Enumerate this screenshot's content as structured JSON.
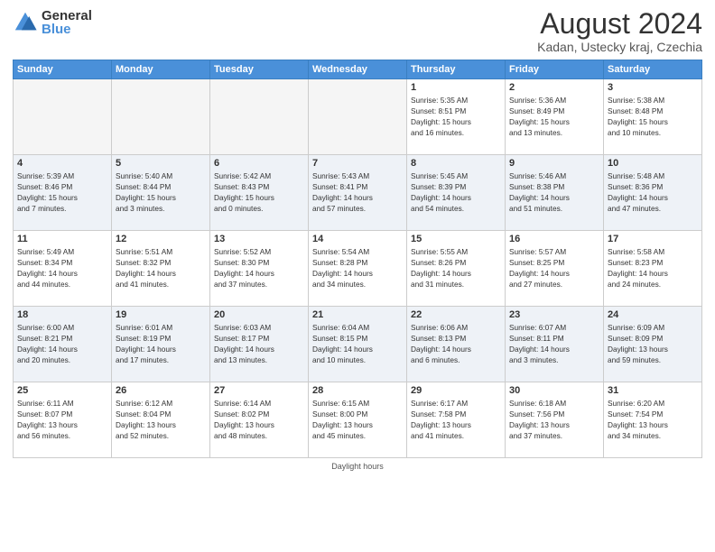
{
  "header": {
    "logo_general": "General",
    "logo_blue": "Blue",
    "month_year": "August 2024",
    "location": "Kadan, Ustecky kraj, Czechia"
  },
  "days_of_week": [
    "Sunday",
    "Monday",
    "Tuesday",
    "Wednesday",
    "Thursday",
    "Friday",
    "Saturday"
  ],
  "footer": {
    "note": "Daylight hours"
  },
  "weeks": [
    {
      "row_class": "row-even",
      "days": [
        {
          "num": "",
          "info": "",
          "empty": true
        },
        {
          "num": "",
          "info": "",
          "empty": true
        },
        {
          "num": "",
          "info": "",
          "empty": true
        },
        {
          "num": "",
          "info": "",
          "empty": true
        },
        {
          "num": "1",
          "info": "Sunrise: 5:35 AM\nSunset: 8:51 PM\nDaylight: 15 hours\nand 16 minutes.",
          "empty": false
        },
        {
          "num": "2",
          "info": "Sunrise: 5:36 AM\nSunset: 8:49 PM\nDaylight: 15 hours\nand 13 minutes.",
          "empty": false
        },
        {
          "num": "3",
          "info": "Sunrise: 5:38 AM\nSunset: 8:48 PM\nDaylight: 15 hours\nand 10 minutes.",
          "empty": false
        }
      ]
    },
    {
      "row_class": "row-odd",
      "days": [
        {
          "num": "4",
          "info": "Sunrise: 5:39 AM\nSunset: 8:46 PM\nDaylight: 15 hours\nand 7 minutes.",
          "empty": false
        },
        {
          "num": "5",
          "info": "Sunrise: 5:40 AM\nSunset: 8:44 PM\nDaylight: 15 hours\nand 3 minutes.",
          "empty": false
        },
        {
          "num": "6",
          "info": "Sunrise: 5:42 AM\nSunset: 8:43 PM\nDaylight: 15 hours\nand 0 minutes.",
          "empty": false
        },
        {
          "num": "7",
          "info": "Sunrise: 5:43 AM\nSunset: 8:41 PM\nDaylight: 14 hours\nand 57 minutes.",
          "empty": false
        },
        {
          "num": "8",
          "info": "Sunrise: 5:45 AM\nSunset: 8:39 PM\nDaylight: 14 hours\nand 54 minutes.",
          "empty": false
        },
        {
          "num": "9",
          "info": "Sunrise: 5:46 AM\nSunset: 8:38 PM\nDaylight: 14 hours\nand 51 minutes.",
          "empty": false
        },
        {
          "num": "10",
          "info": "Sunrise: 5:48 AM\nSunset: 8:36 PM\nDaylight: 14 hours\nand 47 minutes.",
          "empty": false
        }
      ]
    },
    {
      "row_class": "row-even",
      "days": [
        {
          "num": "11",
          "info": "Sunrise: 5:49 AM\nSunset: 8:34 PM\nDaylight: 14 hours\nand 44 minutes.",
          "empty": false
        },
        {
          "num": "12",
          "info": "Sunrise: 5:51 AM\nSunset: 8:32 PM\nDaylight: 14 hours\nand 41 minutes.",
          "empty": false
        },
        {
          "num": "13",
          "info": "Sunrise: 5:52 AM\nSunset: 8:30 PM\nDaylight: 14 hours\nand 37 minutes.",
          "empty": false
        },
        {
          "num": "14",
          "info": "Sunrise: 5:54 AM\nSunset: 8:28 PM\nDaylight: 14 hours\nand 34 minutes.",
          "empty": false
        },
        {
          "num": "15",
          "info": "Sunrise: 5:55 AM\nSunset: 8:26 PM\nDaylight: 14 hours\nand 31 minutes.",
          "empty": false
        },
        {
          "num": "16",
          "info": "Sunrise: 5:57 AM\nSunset: 8:25 PM\nDaylight: 14 hours\nand 27 minutes.",
          "empty": false
        },
        {
          "num": "17",
          "info": "Sunrise: 5:58 AM\nSunset: 8:23 PM\nDaylight: 14 hours\nand 24 minutes.",
          "empty": false
        }
      ]
    },
    {
      "row_class": "row-odd",
      "days": [
        {
          "num": "18",
          "info": "Sunrise: 6:00 AM\nSunset: 8:21 PM\nDaylight: 14 hours\nand 20 minutes.",
          "empty": false
        },
        {
          "num": "19",
          "info": "Sunrise: 6:01 AM\nSunset: 8:19 PM\nDaylight: 14 hours\nand 17 minutes.",
          "empty": false
        },
        {
          "num": "20",
          "info": "Sunrise: 6:03 AM\nSunset: 8:17 PM\nDaylight: 14 hours\nand 13 minutes.",
          "empty": false
        },
        {
          "num": "21",
          "info": "Sunrise: 6:04 AM\nSunset: 8:15 PM\nDaylight: 14 hours\nand 10 minutes.",
          "empty": false
        },
        {
          "num": "22",
          "info": "Sunrise: 6:06 AM\nSunset: 8:13 PM\nDaylight: 14 hours\nand 6 minutes.",
          "empty": false
        },
        {
          "num": "23",
          "info": "Sunrise: 6:07 AM\nSunset: 8:11 PM\nDaylight: 14 hours\nand 3 minutes.",
          "empty": false
        },
        {
          "num": "24",
          "info": "Sunrise: 6:09 AM\nSunset: 8:09 PM\nDaylight: 13 hours\nand 59 minutes.",
          "empty": false
        }
      ]
    },
    {
      "row_class": "row-even",
      "days": [
        {
          "num": "25",
          "info": "Sunrise: 6:11 AM\nSunset: 8:07 PM\nDaylight: 13 hours\nand 56 minutes.",
          "empty": false
        },
        {
          "num": "26",
          "info": "Sunrise: 6:12 AM\nSunset: 8:04 PM\nDaylight: 13 hours\nand 52 minutes.",
          "empty": false
        },
        {
          "num": "27",
          "info": "Sunrise: 6:14 AM\nSunset: 8:02 PM\nDaylight: 13 hours\nand 48 minutes.",
          "empty": false
        },
        {
          "num": "28",
          "info": "Sunrise: 6:15 AM\nSunset: 8:00 PM\nDaylight: 13 hours\nand 45 minutes.",
          "empty": false
        },
        {
          "num": "29",
          "info": "Sunrise: 6:17 AM\nSunset: 7:58 PM\nDaylight: 13 hours\nand 41 minutes.",
          "empty": false
        },
        {
          "num": "30",
          "info": "Sunrise: 6:18 AM\nSunset: 7:56 PM\nDaylight: 13 hours\nand 37 minutes.",
          "empty": false
        },
        {
          "num": "31",
          "info": "Sunrise: 6:20 AM\nSunset: 7:54 PM\nDaylight: 13 hours\nand 34 minutes.",
          "empty": false
        }
      ]
    }
  ]
}
